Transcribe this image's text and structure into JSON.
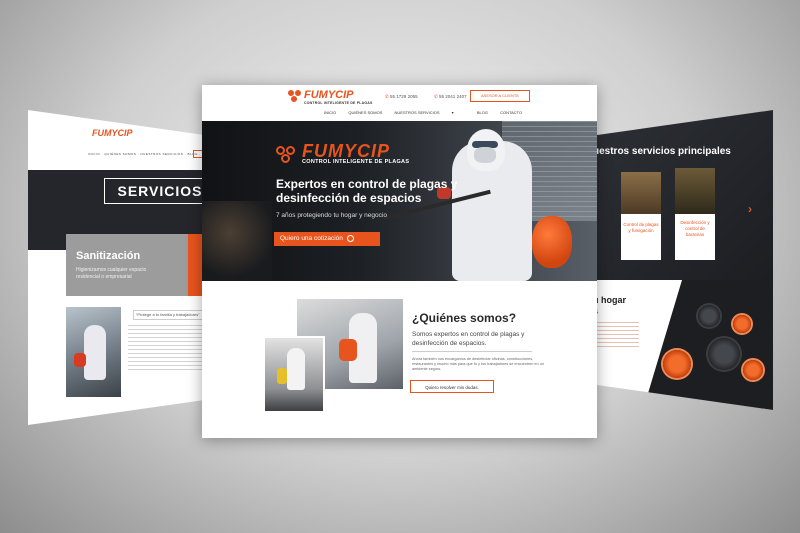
{
  "left_page": {
    "logo": "FUMYCIP",
    "servicios_title": "SERVICIOS",
    "card_title": "Sanitización",
    "card_desc": "Higienizamos cualquier espacio residencial o empresarial",
    "quote": "“Protege a tu familia y trabajadores”"
  },
  "center_page": {
    "logo_name": "FUMYCIP",
    "logo_tagline": "CONTROL INTELIGENTE DE PLAGAS",
    "phone1": "55 1729 2055",
    "phone2": "55 2041 2407",
    "advisor_button": "ASESOR A CLIENTE",
    "nav": [
      "INICIO",
      "QUIÉNES SOMOS",
      "NUESTROS SERVICIOS",
      "BLOG",
      "CONTACTO"
    ],
    "hero": {
      "logo_name": "FUMYCIP",
      "logo_tagline": "CONTROL INTELIGENTE DE PLAGAS",
      "headline": "Expertos en control de plagas y desinfección de espacios",
      "subtitle": "7 años protegiendo tu hogar y negocio",
      "cta": "Quiero una cotización"
    },
    "about": {
      "title": "¿Quiénes somos?",
      "lead": "Somos expertos en control de plagas y desinfección de espacios.",
      "body": "Ahora también nos encargamos de desinfectar oficinas, construcciones, restaurantes y mucho más para que tú y tus trabajadores se encuentren en un ambiente seguro.",
      "button": "Quiero resolver mis dudas."
    }
  },
  "right_page": {
    "title": "uestros servicios principales",
    "card1": "Control de plagas y fumigación",
    "card2": "Desinfección y control de bacterias",
    "hogar": "u hogar",
    "hogar2": "s"
  },
  "colors": {
    "accent": "#e8541e",
    "dark": "#1d2024"
  }
}
